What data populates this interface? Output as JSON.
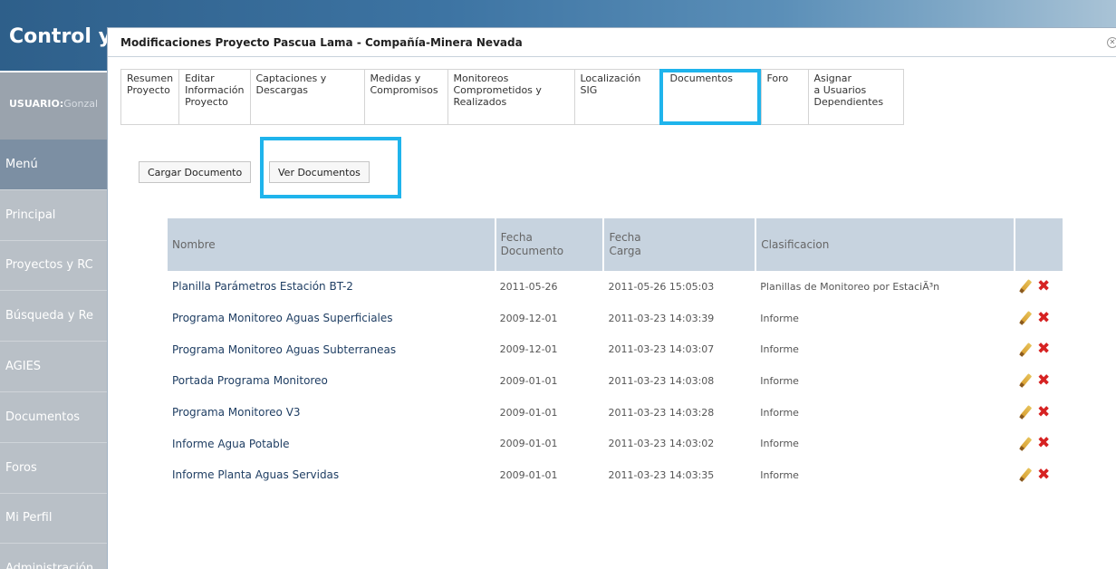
{
  "background": {
    "app_title": "Control y",
    "user_label": "USUARIO:",
    "user_name": "Gonzal"
  },
  "sidebar": {
    "items": [
      {
        "label": "Menú"
      },
      {
        "label": "Principal"
      },
      {
        "label": "Proyectos y RC"
      },
      {
        "label": "Búsqueda y Re"
      },
      {
        "label": "AGIES"
      },
      {
        "label": "Documentos"
      },
      {
        "label": "Foros"
      },
      {
        "label": "Mi Perfil"
      },
      {
        "label": "Administración"
      }
    ]
  },
  "modal": {
    "title": "Modificaciones Proyecto Pascua Lama - Compañía-Minera Nevada",
    "close_glyph": "✕"
  },
  "tabs": [
    {
      "label": "Resumen\nProyecto"
    },
    {
      "label": "Editar\nInformación\nProyecto"
    },
    {
      "label": "Captaciones y\nDescargas"
    },
    {
      "label": "Medidas y\nCompromisos"
    },
    {
      "label": "Monitoreos\nComprometidos y\nRealizados"
    },
    {
      "label": "Localización\nSIG"
    },
    {
      "label": "Documentos"
    },
    {
      "label": "Foro"
    },
    {
      "label": "Asignar\na Usuarios\nDependientes"
    }
  ],
  "buttons": {
    "upload": "Cargar Documento",
    "view": "Ver Documentos"
  },
  "table": {
    "headers": {
      "name": "Nombre",
      "doc_date": "Fecha\nDocumento",
      "upload_date": "Fecha\nCarga",
      "classification": "Clasificacion"
    },
    "rows": [
      {
        "name": "Planilla Parámetros Estación BT-2",
        "doc_date": "2011-05-26",
        "upload_date": "2011-05-26 15:05:03",
        "classification": "Planillas de Monitoreo por EstaciÃ³n"
      },
      {
        "name": "Programa Monitoreo Aguas Superficiales",
        "doc_date": "2009-12-01",
        "upload_date": "2011-03-23 14:03:39",
        "classification": "Informe"
      },
      {
        "name": "Programa Monitoreo Aguas Subterraneas",
        "doc_date": "2009-12-01",
        "upload_date": "2011-03-23 14:03:07",
        "classification": "Informe"
      },
      {
        "name": "Portada Programa Monitoreo",
        "doc_date": "2009-01-01",
        "upload_date": "2011-03-23 14:03:08",
        "classification": "Informe"
      },
      {
        "name": "Programa Monitoreo V3",
        "doc_date": "2009-01-01",
        "upload_date": "2011-03-23 14:03:28",
        "classification": "Informe"
      },
      {
        "name": "Informe Agua Potable",
        "doc_date": "2009-01-01",
        "upload_date": "2011-03-23 14:03:02",
        "classification": "Informe"
      },
      {
        "name": "Informe Planta Aguas Servidas",
        "doc_date": "2009-01-01",
        "upload_date": "2011-03-23 14:03:35",
        "classification": "Informe"
      }
    ],
    "delete_glyph": "✖"
  },
  "colors": {
    "accent_highlight": "#1fb4ec",
    "header_bg": "#c7d3df",
    "link_text": "#1f3e63",
    "delete_red": "#d62222"
  }
}
